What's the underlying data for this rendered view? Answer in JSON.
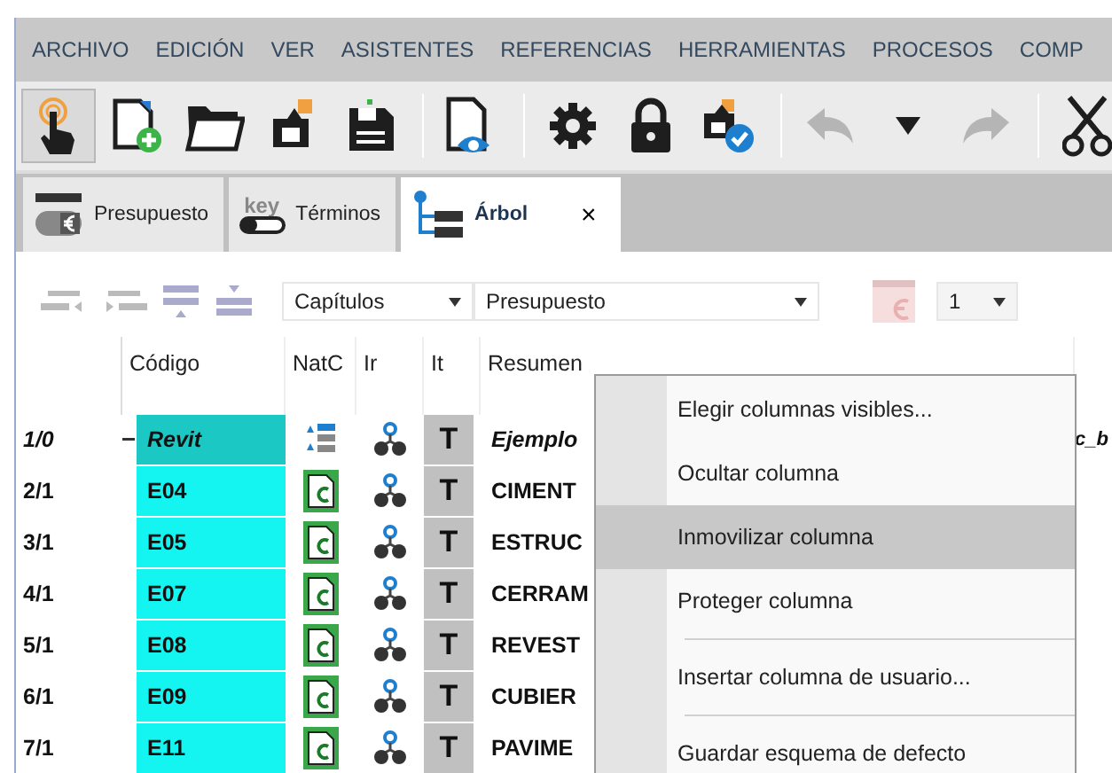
{
  "menu_bar": [
    "ARCHIVO",
    "EDICIÓN",
    "VER",
    "ASISTENTES",
    "REFERENCIAS",
    "HERRAMIENTAS",
    "PROCESOS",
    "COMP"
  ],
  "toolbar_groups": [
    [
      {
        "kind": "touch",
        "selected": true,
        "disabled": false
      },
      {
        "kind": "new",
        "selected": false,
        "disabled": false
      },
      {
        "kind": "open",
        "selected": false,
        "disabled": false
      },
      {
        "kind": "upload",
        "selected": false,
        "disabled": false
      },
      {
        "kind": "save",
        "selected": false,
        "disabled": false
      }
    ],
    [
      {
        "kind": "preview",
        "selected": false,
        "disabled": false
      }
    ],
    [
      {
        "kind": "settings",
        "selected": false,
        "disabled": false
      },
      {
        "kind": "lock",
        "selected": false,
        "disabled": false
      },
      {
        "kind": "check",
        "selected": false,
        "disabled": false
      }
    ],
    [
      {
        "kind": "undo",
        "selected": false,
        "disabled": true
      },
      {
        "kind": "dropdown",
        "selected": false,
        "disabled": false
      },
      {
        "kind": "redo",
        "selected": false,
        "disabled": true
      }
    ],
    [
      {
        "kind": "cut",
        "selected": false,
        "disabled": false
      }
    ]
  ],
  "tabs": [
    {
      "label": "Presupuesto",
      "kind": "budget",
      "selected": false
    },
    {
      "label": "Términos",
      "kind": "terms",
      "icon_text": "key",
      "selected": false
    },
    {
      "label": "Árbol",
      "kind": "tree",
      "selected": true,
      "close": "×"
    }
  ],
  "grid_toolbar": {
    "level_dropdown": {
      "value": "Capítulos"
    },
    "view_dropdown": {
      "value": "Presupuesto"
    },
    "number_dropdown": {
      "value": "1"
    }
  },
  "table": {
    "columns": [
      "Código",
      "NatC",
      "Ir",
      "It",
      "Resumen"
    ],
    "rows": [
      {
        "number": "1/0",
        "code": "Revit",
        "kind": "root",
        "expanded": true,
        "type_mark": "T",
        "summary": "Ejemplo",
        "column_7": "c_b"
      },
      {
        "number": "2/1",
        "code": "E04",
        "kind": "chapter",
        "type_mark": "T",
        "summary": "CIMENT"
      },
      {
        "number": "3/1",
        "code": "E05",
        "kind": "chapter",
        "type_mark": "T",
        "summary": "ESTRUC"
      },
      {
        "number": "4/1",
        "code": "E07",
        "kind": "chapter",
        "type_mark": "T",
        "summary": "CERRAM"
      },
      {
        "number": "5/1",
        "code": "E08",
        "kind": "chapter",
        "type_mark": "T",
        "summary": "REVEST"
      },
      {
        "number": "6/1",
        "code": "E09",
        "kind": "chapter",
        "type_mark": "T",
        "summary": "CUBIER"
      },
      {
        "number": "7/1",
        "code": "E11",
        "kind": "chapter",
        "type_mark": "T",
        "summary": "PAVIME"
      }
    ]
  },
  "context_menu": {
    "groups": [
      [
        {
          "label": "Elegir columnas visibles...",
          "selected": false
        },
        {
          "label": "Ocultar columna",
          "selected": false
        },
        {
          "label": "Inmovilizar columna",
          "selected": true
        },
        {
          "label": "Proteger columna",
          "selected": false
        }
      ],
      [
        {
          "label": "Insertar columna de usuario...",
          "selected": false
        }
      ],
      [
        {
          "label": "Guardar esquema de defecto",
          "selected": false
        }
      ]
    ]
  }
}
